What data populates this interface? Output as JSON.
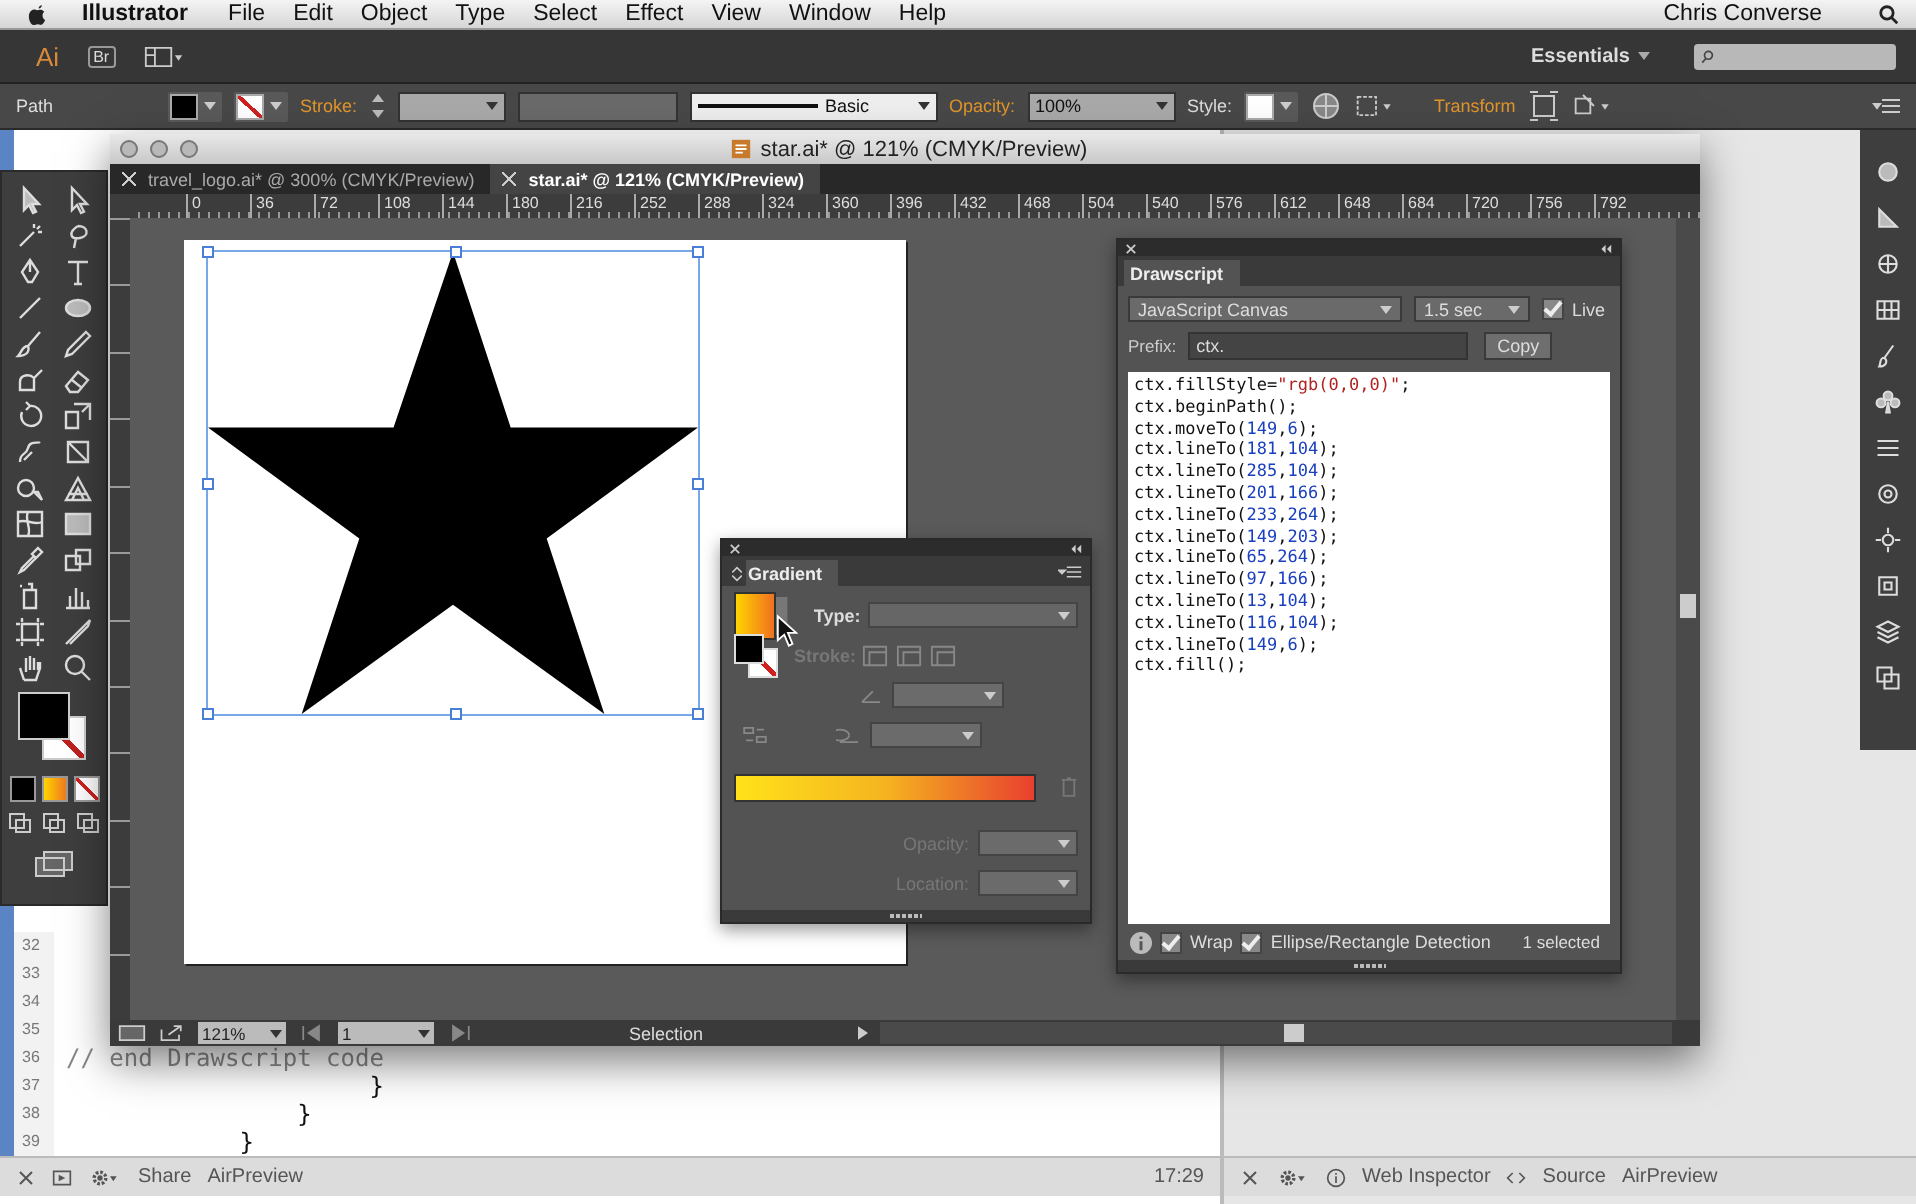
{
  "menubar": {
    "app": "Illustrator",
    "menus": [
      "File",
      "Edit",
      "Object",
      "Type",
      "Select",
      "Effect",
      "View",
      "Window",
      "Help"
    ],
    "user": "Chris Converse"
  },
  "appbar": {
    "logo": "Ai",
    "bridge": "Br",
    "workspace": "Essentials"
  },
  "control_bar": {
    "selection": "Path",
    "stroke_label": "Stroke:",
    "brush": "Basic",
    "opacity_label": "Opacity:",
    "opacity": "100%",
    "style_label": "Style:",
    "transform": "Transform"
  },
  "document_window": {
    "title": "star.ai* @ 121% (CMYK/Preview)",
    "tabs": [
      {
        "label": "travel_logo.ai* @ 300% (CMYK/Preview)",
        "selected": false
      },
      {
        "label": "star.ai* @ 121% (CMYK/Preview)",
        "selected": true
      }
    ],
    "ruler": [
      "0",
      "36",
      "72",
      "108",
      "144",
      "180",
      "216",
      "252",
      "288",
      "324",
      "360",
      "396",
      "432",
      "468",
      "504",
      "540",
      "576",
      "612",
      "648",
      "684",
      "720",
      "756",
      "792"
    ],
    "status": {
      "zoom": "121%",
      "artboard": "1",
      "tool": "Selection"
    }
  },
  "gradient_panel": {
    "title": "Gradient",
    "type_label": "Type:",
    "stroke_label": "Stroke:",
    "opacity_label": "Opacity:",
    "location_label": "Location:"
  },
  "drawscript_panel": {
    "title": "Drawscript",
    "format": "JavaScript Canvas",
    "interval": "1.5 sec",
    "live": {
      "label": "Live",
      "checked": true
    },
    "prefix_label": "Prefix:",
    "prefix": "ctx.",
    "copy": "Copy",
    "code": [
      "ctx.fillStyle=\"rgb(0,0,0)\";",
      "ctx.beginPath();",
      "ctx.moveTo(149,6);",
      "ctx.lineTo(181,104);",
      "ctx.lineTo(285,104);",
      "ctx.lineTo(201,166);",
      "ctx.lineTo(233,264);",
      "ctx.lineTo(149,203);",
      "ctx.lineTo(65,264);",
      "ctx.lineTo(97,166);",
      "ctx.lineTo(13,104);",
      "ctx.lineTo(116,104);",
      "ctx.lineTo(149,6);",
      "ctx.fill();"
    ],
    "wrap": {
      "label": "Wrap",
      "checked": true
    },
    "detection": {
      "label": "Ellipse/Rectangle Detection",
      "checked": true
    },
    "selection_count": "1 selected"
  },
  "code_editor": {
    "lines": [
      {
        "number": "32"
      },
      {
        "number": "33"
      },
      {
        "number": "34"
      },
      {
        "number": "35"
      },
      {
        "number": "36",
        "text": "// end Drawscript code"
      },
      {
        "number": "37",
        "text": "                     }"
      },
      {
        "number": "38",
        "text": "                }"
      },
      {
        "number": "39",
        "text": "            }"
      }
    ]
  },
  "status_bars": {
    "left": {
      "share": "Share",
      "preview": "AirPreview",
      "time": "17:29"
    },
    "right": {
      "inspector": "Web Inspector",
      "source": "Source",
      "preview": "AirPreview"
    }
  }
}
